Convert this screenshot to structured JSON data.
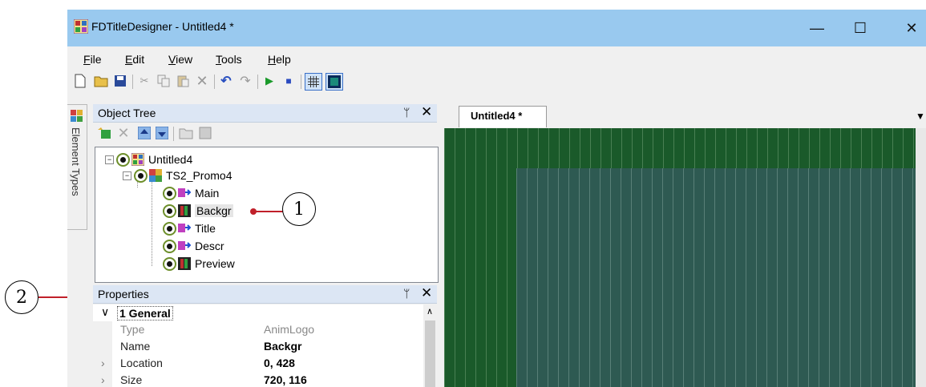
{
  "window": {
    "title": "FDTitleDesigner - Untitled4 *"
  },
  "controls": {
    "minimize": "—",
    "maximize": "☐",
    "close": "✕"
  },
  "menu": [
    {
      "label": "File",
      "key": "F",
      "rest": "ile"
    },
    {
      "label": "Edit",
      "key": "E",
      "rest": "dit"
    },
    {
      "label": "View",
      "key": "V",
      "rest": "iew"
    },
    {
      "label": "Tools",
      "key": "T",
      "rest": "ools"
    },
    {
      "label": "Help",
      "key": "H",
      "rest": "elp"
    }
  ],
  "side_strip": {
    "label": "Element Types"
  },
  "object_tree": {
    "title": "Object Tree",
    "pin": "⬇",
    "close": "✕",
    "nodes": [
      {
        "label": "Untitled4",
        "level": 0
      },
      {
        "label": "TS2_Promo4",
        "level": 1
      },
      {
        "label": "Main",
        "level": 2
      },
      {
        "label": "Backgr",
        "level": 2
      },
      {
        "label": "Title",
        "level": 2
      },
      {
        "label": "Descr",
        "level": 2
      },
      {
        "label": "Preview",
        "level": 2
      }
    ]
  },
  "properties": {
    "title": "Properties",
    "group": "1 General",
    "rows": [
      {
        "key": "Type",
        "value": "AnimLogo"
      },
      {
        "key": "Name",
        "value": "Backgr"
      },
      {
        "key": "Location",
        "value": "0, 428"
      },
      {
        "key": "Size",
        "value": "720, 116"
      }
    ]
  },
  "document": {
    "tab": "Untitled4 *"
  },
  "callouts": {
    "one": "1",
    "two": "2"
  },
  "colors": {
    "titlebar": "#99c9ef",
    "panel_header": "#dce6f4",
    "canvas_green": "#1a5a2a",
    "canvas_teal": "#2e5a52",
    "callout_red": "#c0202a"
  }
}
